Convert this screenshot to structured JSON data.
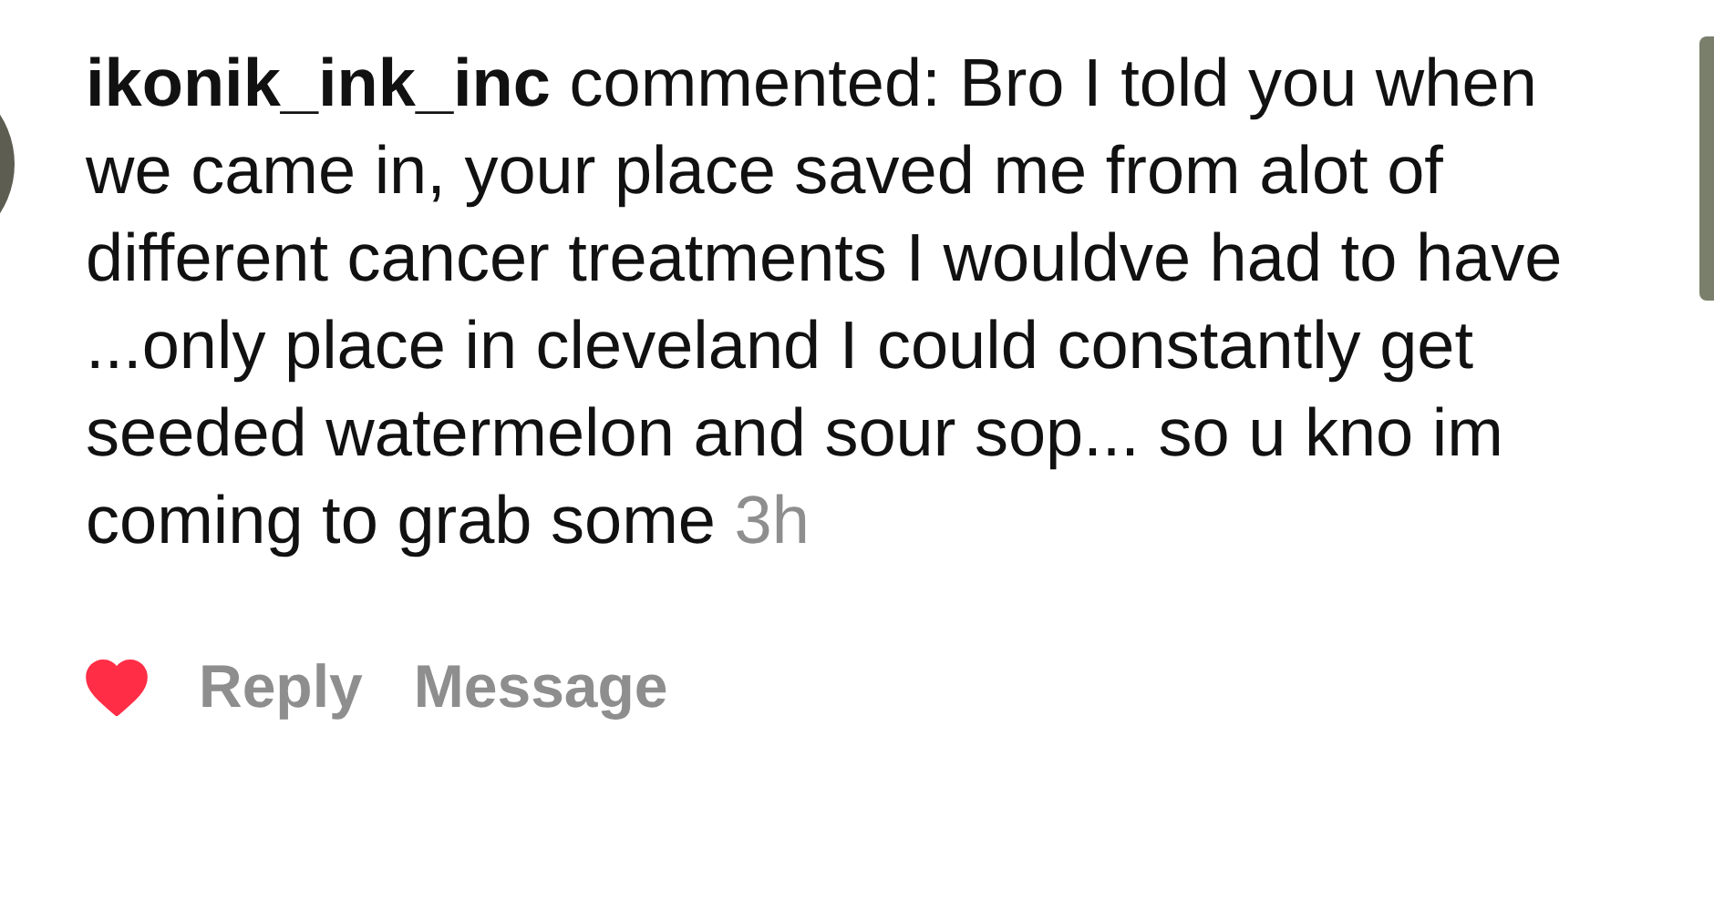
{
  "comment": {
    "username": "ikonik_ink_inc",
    "text": "commented: Bro I told you when we came in, your place saved me from alot of different cancer treatments I wouldve had to have ...only place in cleveland I could constantly get seeded watermelon and sour sop... so u kno im coming to grab some",
    "time": "3h"
  },
  "liked": true,
  "actions": [
    "Reply",
    "Message"
  ]
}
